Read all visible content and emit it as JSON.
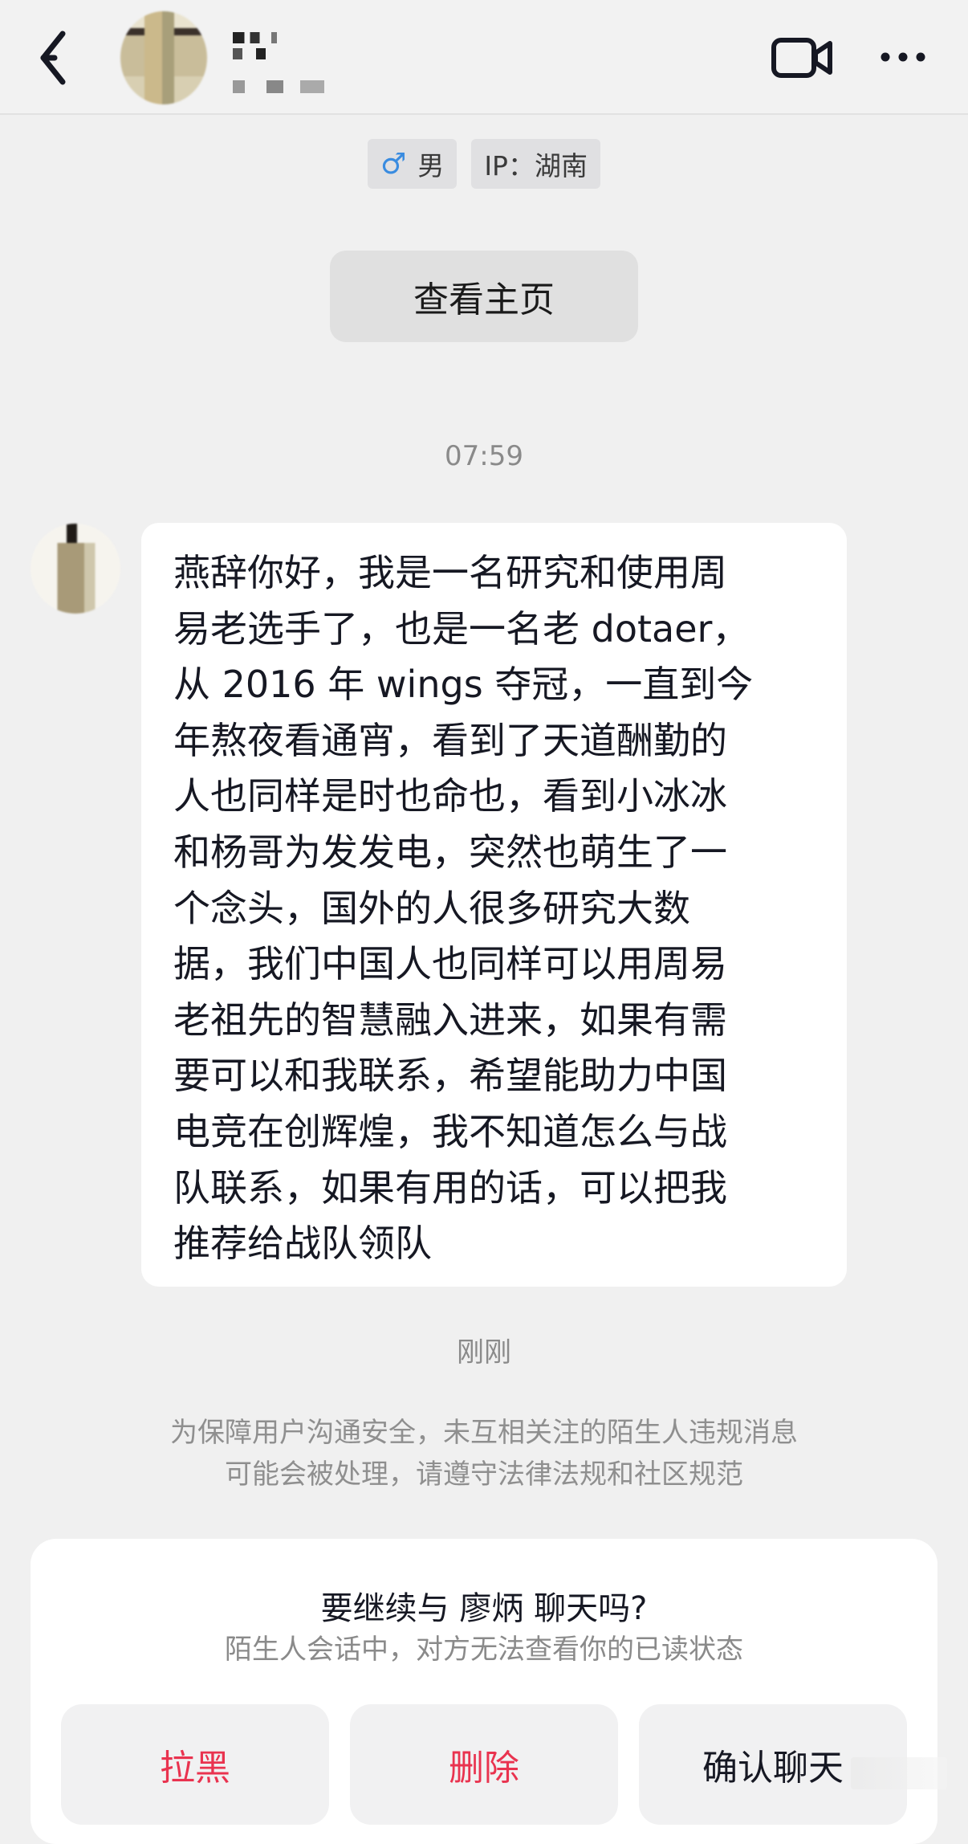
{
  "tags": {
    "gender": "男",
    "ip": "IP：湖南"
  },
  "profile_button": "查看主页",
  "timestamp": "07:59",
  "message": {
    "lines": [
      "燕辞你好，我是一名研究和使用周",
      "易老选手了，也是一名老 dotaer，",
      "从 2016 年 wings 夺冠，一直到今",
      "年熬夜看通宵，看到了天道酬勤的",
      "人也同样是时也命也，看到小冰冰",
      "和杨哥为发发电，突然也萌生了一",
      "个念头，国外的人很多研究大数",
      "据，我们中国人也同样可以用周易",
      "老祖先的智慧融入进来，如果有需",
      "要可以和我联系，希望能助力中国",
      "电竞在创辉煌，我不知道怎么与战",
      "队联系，如果有用的话，可以把我",
      "推荐给战队领队"
    ]
  },
  "sent_status": "刚刚",
  "notice_lines": [
    "为保障用户沟通安全，未互相关注的陌生人违规消息",
    "可能会被处理，请遵守法律法规和社区规范"
  ],
  "prompt": {
    "title": "要继续与 廖炳 聊天吗?",
    "subtitle": "陌生人会话中，对方无法查看你的已读状态",
    "block_label": "拉黑",
    "delete_label": "删除",
    "confirm_label": "确认聊天"
  },
  "colors": {
    "danger": "#e9334f",
    "male": "#3a8ce0",
    "background": "#f0f0f0"
  },
  "icons": [
    "back-arrow-icon",
    "video-call-icon",
    "more-icon",
    "male-icon"
  ]
}
